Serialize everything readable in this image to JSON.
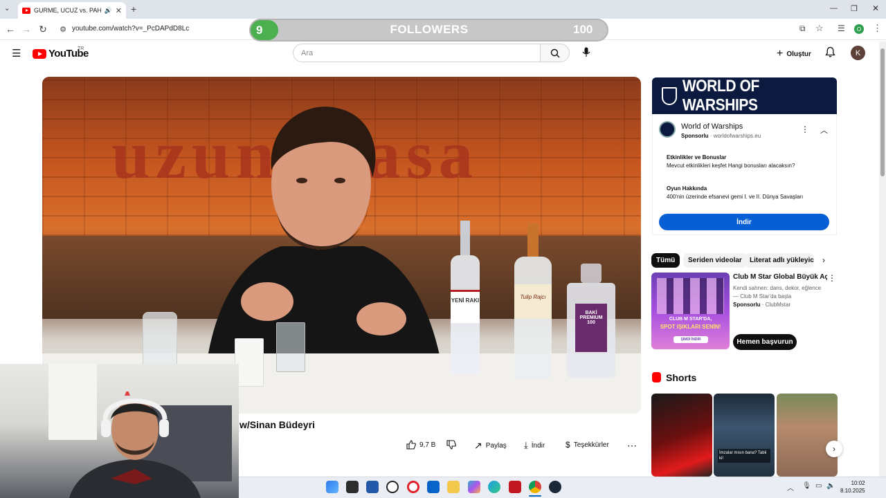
{
  "browser": {
    "tab_title": "GURME, UCUZ vs. PAHALI R",
    "url": "youtube.com/watch?v=_PcDAPdD8Lc",
    "profile_initial": "O"
  },
  "overlay": {
    "followers_current": "9",
    "followers_label": "FOLLOWERS",
    "followers_goal": "100",
    "progress_fraction": 0.09
  },
  "header": {
    "logo": "YouTube",
    "country": "TR",
    "search_placeholder": "Ara",
    "create_label": "Oluştur",
    "avatar_initial": "K"
  },
  "video": {
    "background_text": "uzun masa",
    "bottle_labels": [
      "YENİ RAKI",
      "Tulip Rajcı",
      "BAKİ PREMIUM 100"
    ],
    "title": "w/Sinan Büdeyri"
  },
  "actions": {
    "likes": "9,7 B",
    "share": "Paylaş",
    "download": "İndir",
    "thanks": "Teşekkürler"
  },
  "ad": {
    "banner_text": "WORLD OF WARSHIPS",
    "channel": "World of Warships",
    "sponsored": "Sponsorlu",
    "domain": "worldofwarships.eu",
    "item1_title": "Etkinlikler ve Bonuslar",
    "item1_desc": "Mevcut etkinlikleri keşfet Hangi bonusları alacaksın?",
    "item2_title": "Oyun Hakkında",
    "item2_desc": "400'nin üzerinde efsanevi gemi I. ve II. Dünya Savaşları",
    "install": "İndir"
  },
  "chips": [
    "Tümü",
    "Seriden videolar",
    "Literat adlı yükleyicid"
  ],
  "promo": {
    "title": "Club M Star Global Büyük Açılış",
    "desc": "Kendi sahnen: dans, dekor, eğlence— Club M Star'da başla",
    "sponsored": "Sponsorlu",
    "channel": "ClubMstar",
    "thumb_line1": "CLUB M STAR'DA,",
    "thumb_line2": "SPOT IŞIKLARI SENİN!",
    "thumb_cta": "ŞİMDİ İNDİR",
    "cta": "Hemen başvurun"
  },
  "shorts": {
    "heading": "Shorts",
    "caption": "İmzalar mısın bana? Tabii ki!"
  },
  "taskbar": {
    "time": "10:02",
    "date": "8.10.2025"
  }
}
